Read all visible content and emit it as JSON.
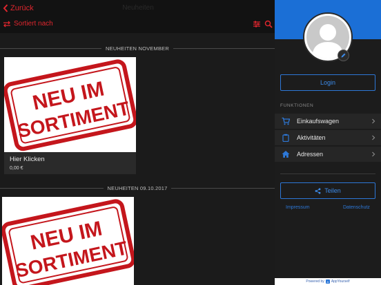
{
  "nav": {
    "back_label": "Zurück",
    "title": "Neuheiten",
    "sort_label": "Sortiert nach",
    "accent": "#e0262e"
  },
  "sections": [
    {
      "header": "NEUHEITEN NOVEMBER",
      "card": {
        "title": "Hier Klicken",
        "price": "0,00 €",
        "stamp_line1": "NEU IM",
        "stamp_line2": "SORTIMENT"
      }
    },
    {
      "header": "NEUHEITEN 09.10.2017",
      "card": {
        "title": "",
        "price": "",
        "stamp_line1": "NEU IM",
        "stamp_line2": "SORTIMENT"
      }
    }
  ],
  "drawer": {
    "header_color": "#1b6fd6",
    "login_label": "Login",
    "functions_label": "FUNKTIONEN",
    "menu": [
      {
        "label": "Einkaufswagen",
        "icon": "cart-icon"
      },
      {
        "label": "Aktivitäten",
        "icon": "clipboard-icon"
      },
      {
        "label": "Adressen",
        "icon": "home-icon"
      }
    ],
    "share_label": "Teilen",
    "impressum_label": "Impressum",
    "datenschutz_label": "Datenschutz",
    "powered_prefix": "Powered by",
    "powered_brand": "AppYourself"
  }
}
